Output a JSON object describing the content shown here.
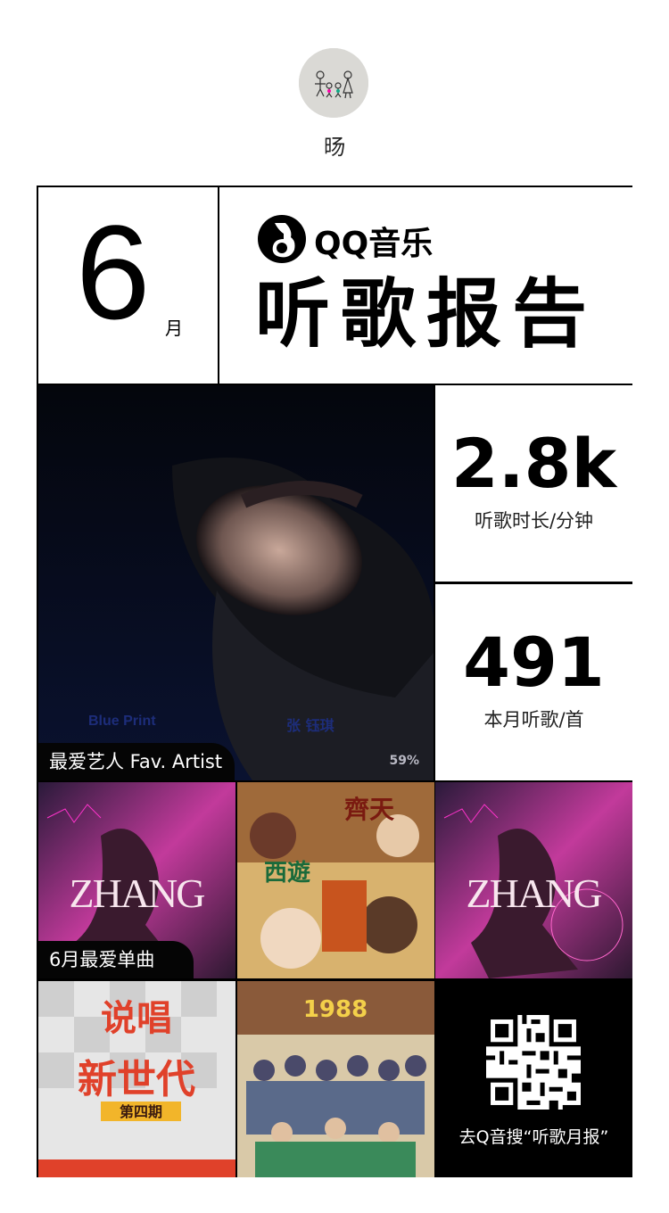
{
  "profile": {
    "username": "旸",
    "avatar_icon": "family-drawing-avatar"
  },
  "header": {
    "month_number": "6",
    "month_unit": "月",
    "brand": "QQ音乐",
    "brand_icon": "qq-music-logo-icon",
    "report_title": "听歌报告"
  },
  "fav_artist": {
    "label": "最爱艺人 Fav. Artist",
    "album_text": "Blue Print",
    "artist_text": "张 钰琪",
    "progress_text": "59%"
  },
  "stats": [
    {
      "value": "2.8k",
      "label": "听歌时长/分钟"
    },
    {
      "value": "491",
      "label": "本月听歌/首"
    }
  ],
  "songs": {
    "label": "6月最爱单曲",
    "tiles": [
      {
        "cover": "ZHANG"
      },
      {
        "cover": "西游记"
      },
      {
        "cover": "ZHANG"
      },
      {
        "cover": "说唱新世代"
      },
      {
        "cover": "1988"
      }
    ]
  },
  "share": {
    "hint": "去Q音搜“听歌月报”"
  },
  "colors": {
    "border": "#000000",
    "card_bg": "#ffffff",
    "label_bg": "#050505"
  }
}
